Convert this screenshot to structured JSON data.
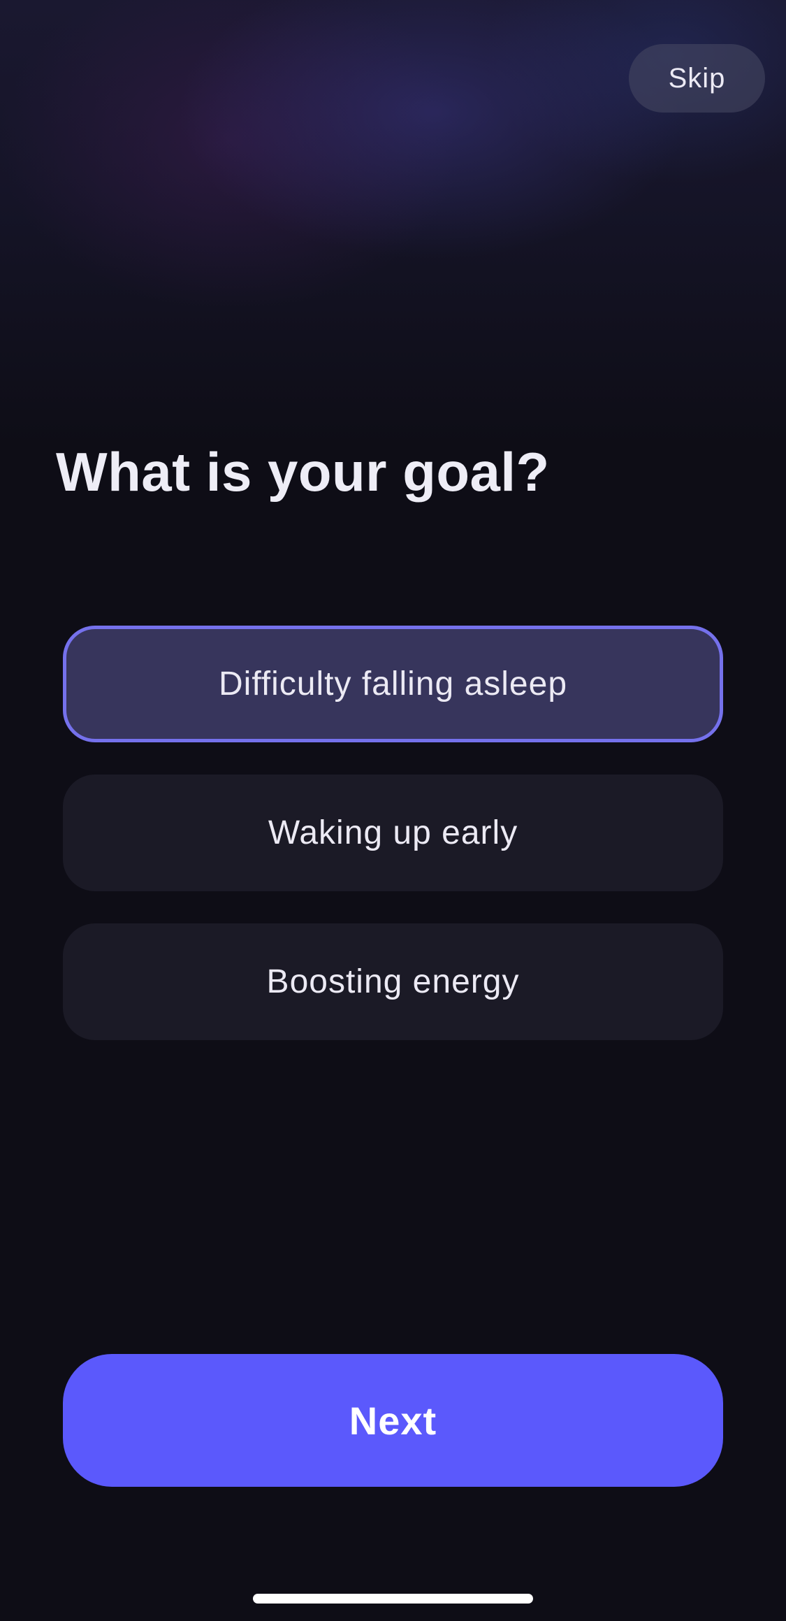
{
  "header": {
    "skip_label": "Skip"
  },
  "main": {
    "title": "What is your goal?",
    "options": [
      {
        "label": "Difficulty falling asleep",
        "selected": true
      },
      {
        "label": "Waking up early",
        "selected": false
      },
      {
        "label": "Boosting energy",
        "selected": false
      }
    ]
  },
  "footer": {
    "next_label": "Next"
  },
  "colors": {
    "background": "#0e0d16",
    "accent": "#5b59fc",
    "selected_border": "#7571ec",
    "selected_fill": "#37355c",
    "option_fill": "#1b1a26"
  }
}
